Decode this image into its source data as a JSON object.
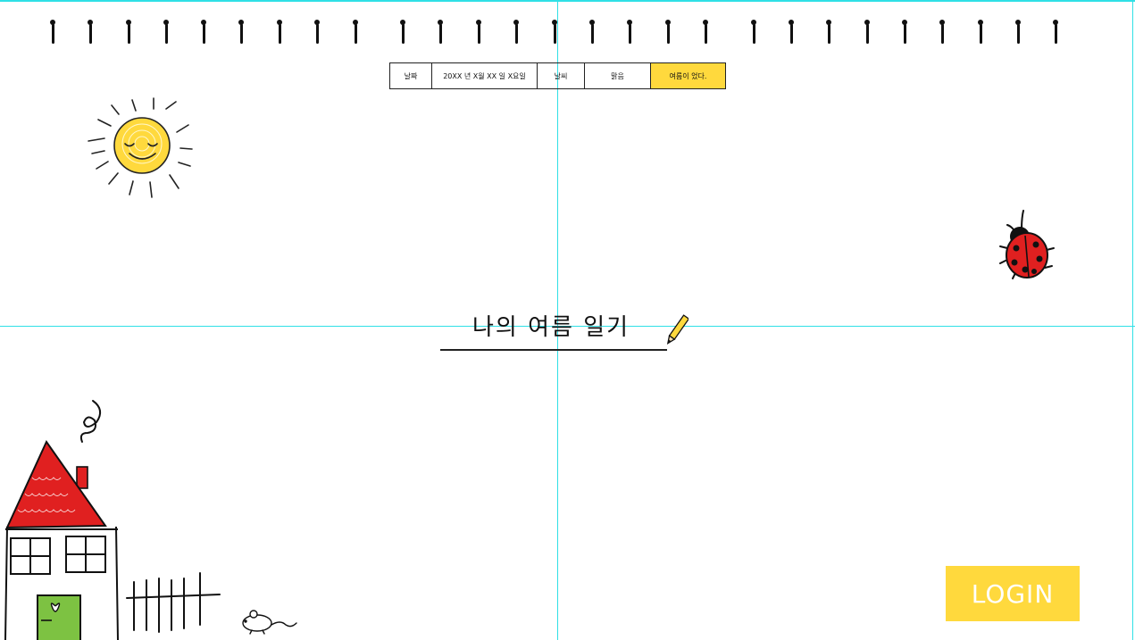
{
  "info": {
    "date_label": "날짜",
    "date_value": "20XX 년 X월 XX 일 X요일",
    "weather_label": "날씨",
    "weather_value": "맑음",
    "note": "여름이 었다."
  },
  "title": "나의 여름 일기",
  "login_label": "LOGIN",
  "colors": {
    "accent": "#ffd93d",
    "guide": "#2fe0e6",
    "roof": "#e02020",
    "door": "#7dc242"
  },
  "icons": [
    "sun-icon",
    "ladybug-icon",
    "house-icon",
    "fence-icon",
    "mouse-icon",
    "pencil-icon",
    "binder-ring-icon"
  ]
}
